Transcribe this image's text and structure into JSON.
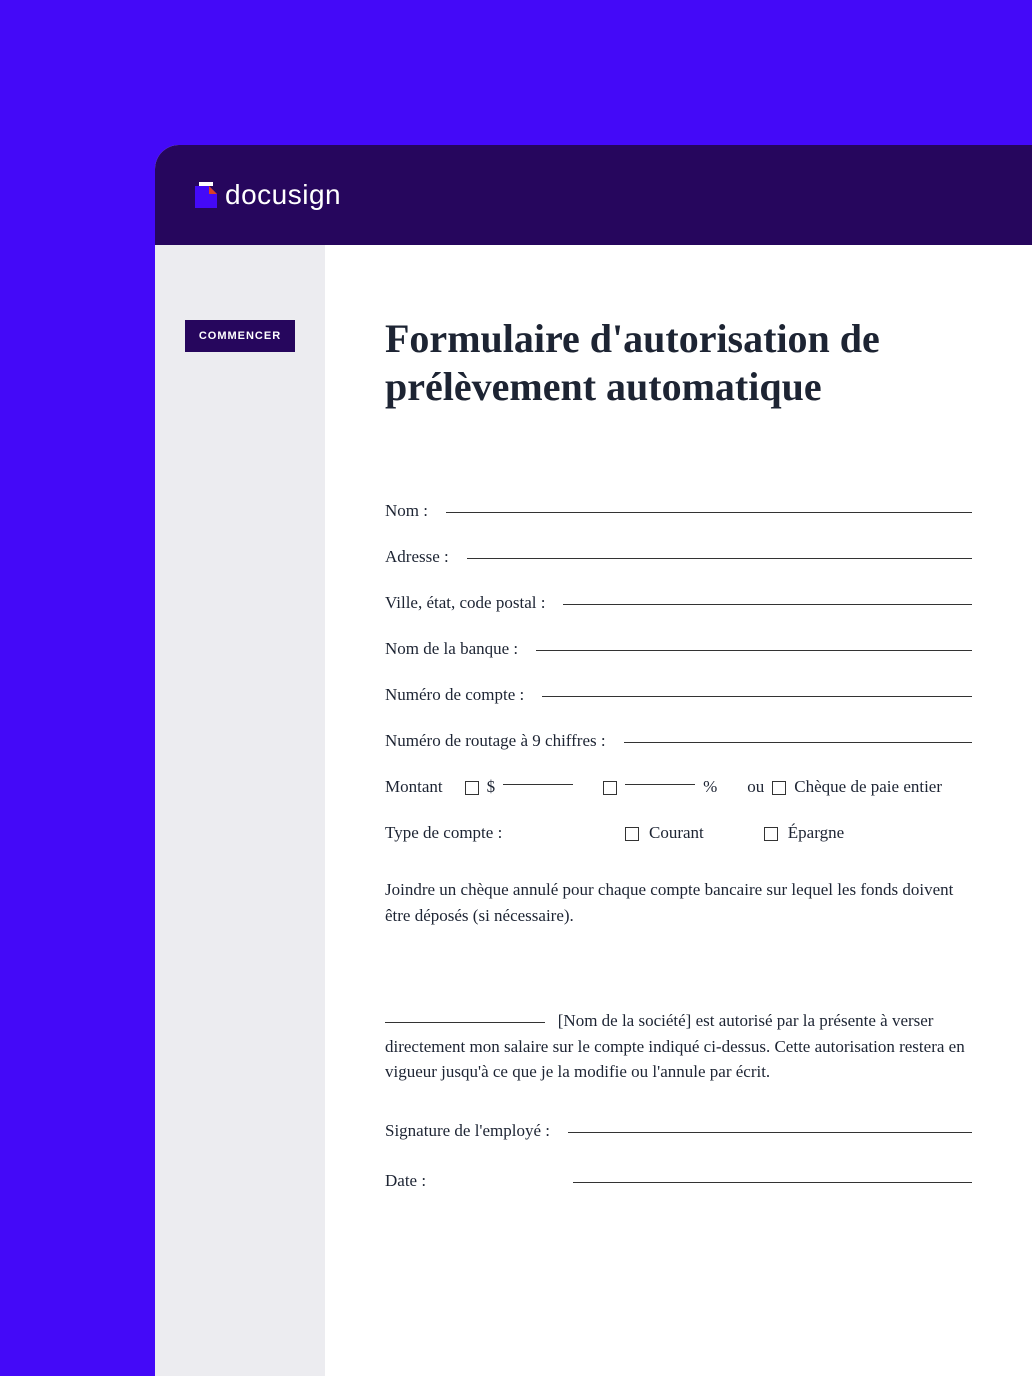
{
  "logo": {
    "text": "docusign"
  },
  "sidebar": {
    "start_label": "COMMENCER"
  },
  "document": {
    "title": "Formulaire d'autorisation de prélèvement automatique",
    "fields": {
      "name": "Nom :",
      "address": "Adresse :",
      "city_state_zip": "Ville, état, code postal :",
      "bank_name": "Nom de la banque :",
      "account_number": "Numéro de compte :",
      "routing_number": "Numéro de routage à 9 chiffres :",
      "amount": "Montant",
      "dollar_sign": "$",
      "percent_sign": "%",
      "or": "ou",
      "entire_check": "Chèque de paie entier",
      "account_type": "Type de compte :",
      "checking": "Courant",
      "savings": "Épargne",
      "signature": "Signature de l'employé :",
      "date": "Date :"
    },
    "note": "Joindre un chèque annulé pour chaque compte bancaire sur lequel les fonds doivent être déposés (si nécessaire).",
    "authorization": "[Nom de la société] est autorisé par la présente à verser directement mon salaire sur le compte indiqué ci-dessus. Cette autorisation restera en vigueur jusqu'à ce que je la modifie ou l'annule par écrit."
  }
}
